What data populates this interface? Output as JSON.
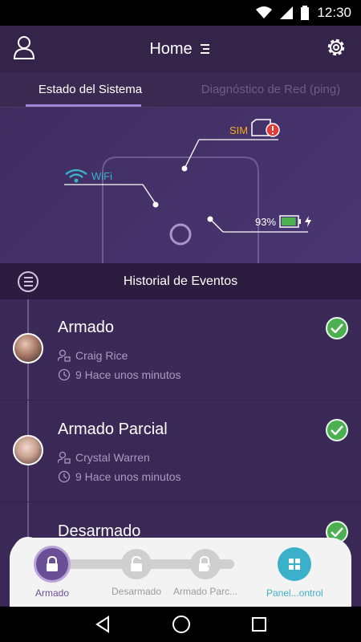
{
  "status_bar": {
    "time": "12:30"
  },
  "app_bar": {
    "title": "Home"
  },
  "tabs": [
    {
      "label": "Estado del Sistema",
      "active": true
    },
    {
      "label": "Diagnóstico de Red (ping)",
      "active": false
    }
  ],
  "diagram": {
    "wifi_label": "WiFi",
    "sim_label": "SIM",
    "battery_percent": "93%",
    "battery_level": 0.93
  },
  "events_header": {
    "title": "Historial de Eventos"
  },
  "events": [
    {
      "title": "Armado",
      "user": "Craig Rice",
      "time": "9 Hace unos minutos"
    },
    {
      "title": "Armado Parcial",
      "user": "Crystal Warren",
      "time": "9 Hace unos minutos"
    },
    {
      "title": "Desarmado",
      "user": "",
      "time": ""
    }
  ],
  "bottom_panel": {
    "items": [
      {
        "label": "Armado",
        "active": true
      },
      {
        "label": "Desarmado",
        "active": false
      },
      {
        "label": "Armado Parc...",
        "active": false
      },
      {
        "label": "Panel...ontrol",
        "active": false
      }
    ]
  },
  "colors": {
    "accent": "#6b4f96",
    "success": "#4caf50",
    "warning": "#f5a623",
    "alert": "#e53935",
    "info": "#3bb0c9"
  }
}
